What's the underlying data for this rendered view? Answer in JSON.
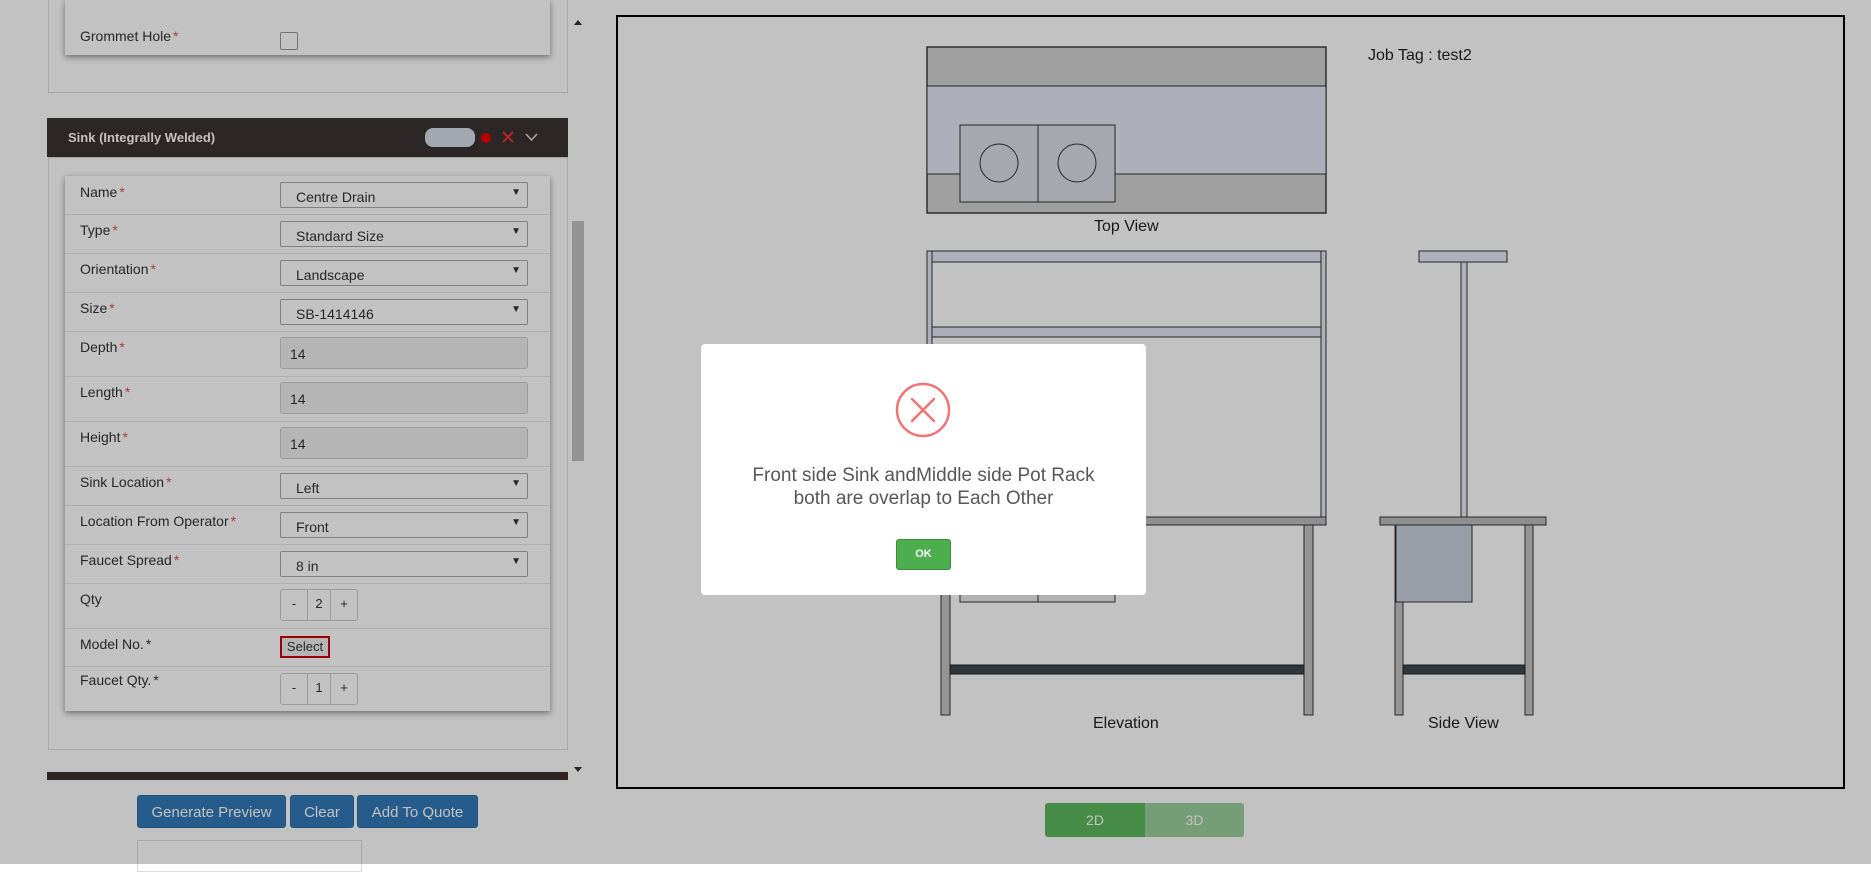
{
  "grommet": {
    "label": "Grommet Hole"
  },
  "sink_section": {
    "title": "Sink (Integrally Welded)"
  },
  "fields": {
    "name": {
      "label": "Name",
      "value": "Centre Drain"
    },
    "type": {
      "label": "Type",
      "value": "Standard Size"
    },
    "orientation": {
      "label": "Orientation",
      "value": "Landscape"
    },
    "size": {
      "label": "Size",
      "value": "SB-1414146"
    },
    "depth": {
      "label": "Depth",
      "value": "14"
    },
    "length": {
      "label": "Length",
      "value": "14"
    },
    "height": {
      "label": "Height",
      "value": "14"
    },
    "sink_location": {
      "label": "Sink Location",
      "value": "Left"
    },
    "location_from_operator": {
      "label": "Location From Operator",
      "value": "Front"
    },
    "faucet_spread": {
      "label": "Faucet Spread",
      "value": "8 in"
    },
    "qty": {
      "label": "Qty",
      "value": "2",
      "minus": "-",
      "plus": "+"
    },
    "model_no": {
      "label": "Model No.",
      "button": "Select"
    },
    "faucet_qty": {
      "label": "Faucet Qty.",
      "value": "1",
      "minus": "-",
      "plus": "+"
    }
  },
  "required_mark": "*",
  "actions": {
    "generate": "Generate Preview",
    "clear": "Clear",
    "add_to_quote": "Add To Quote"
  },
  "drawing": {
    "job_tag": "Job Tag : test2",
    "top_view": "Top View",
    "elevation": "Elevation",
    "side_view": "Side View"
  },
  "view_toggle": {
    "two_d": "2D",
    "three_d": "3D"
  },
  "alert": {
    "message_line1": "Front side Sink andMiddle side Pot Rack",
    "message_line2": "both are overlap to Each Other",
    "ok": "OK"
  },
  "colors": {
    "primary": "#337ab7",
    "success": "#4cae4c",
    "error": "#f27474",
    "header_dark": "#3a3232"
  }
}
